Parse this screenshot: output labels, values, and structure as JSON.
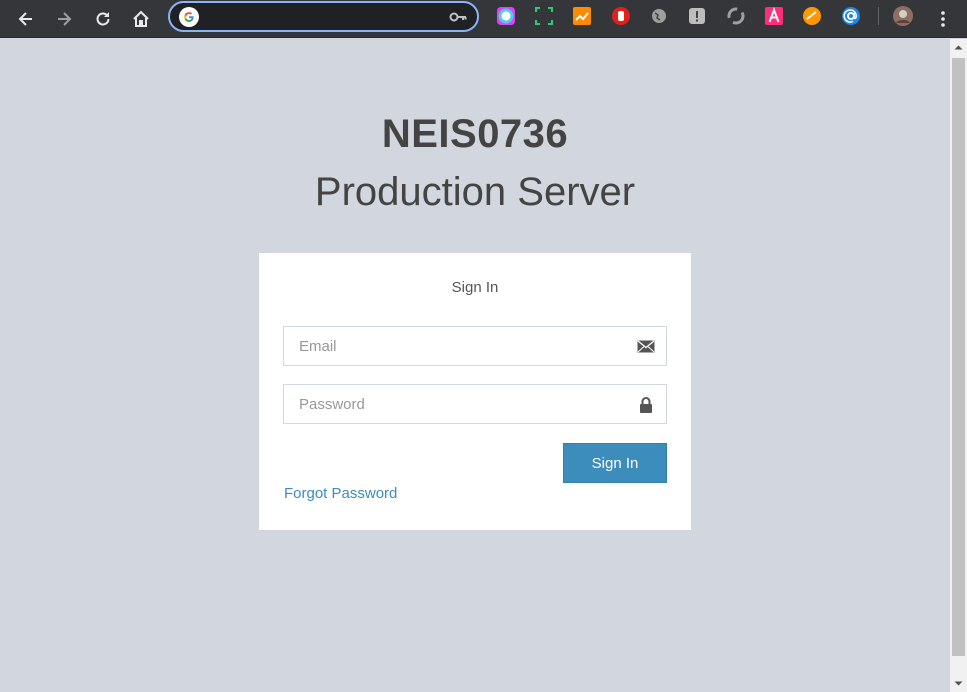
{
  "browser": {
    "address_value": "",
    "icons": [
      "back-icon",
      "forward-icon",
      "reload-icon",
      "home-icon",
      "google-icon",
      "key-icon",
      "menu-icon"
    ],
    "extensions": [
      "color-circle-extension",
      "screenshot-extension",
      "chart-extension",
      "stop-extension",
      "globe-extension",
      "clipboard-extension",
      "sync-extension",
      "letter-a-extension",
      "orange-extension",
      "at-sign-extension",
      "profile-avatar"
    ]
  },
  "page": {
    "title": "NEIS0736",
    "subtitle": "Production Server"
  },
  "login": {
    "heading": "Sign In",
    "email_placeholder": "Email",
    "password_placeholder": "Password",
    "submit_label": "Sign In",
    "forgot_label": "Forgot Password"
  },
  "colors": {
    "background": "#d2d6de",
    "primary": "#3c8dbc",
    "toolbar": "#35363a"
  }
}
